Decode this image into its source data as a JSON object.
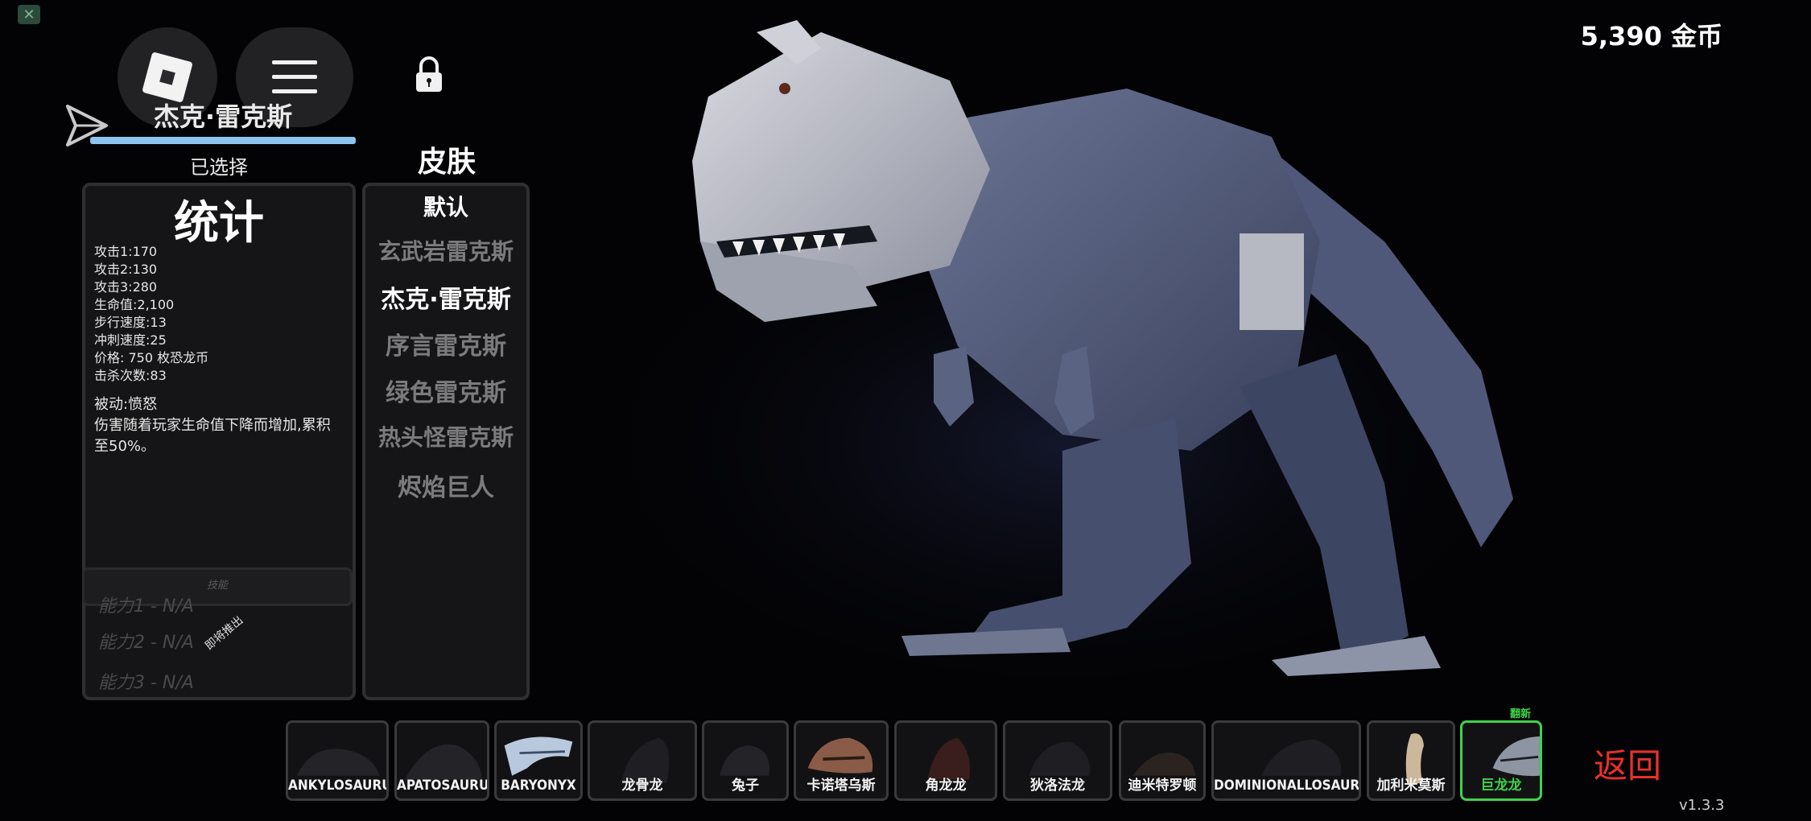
{
  "hud": {
    "close_icon": "close-icon",
    "roblox_logo_icon": "roblox-logo-icon",
    "menu_icon": "hamburger-menu-icon",
    "lock_icon": "lock-icon",
    "share_icon": "paper-plane-icon"
  },
  "dinosaur": {
    "name": "杰克·雷克斯",
    "selected_label": "已选择"
  },
  "stats": {
    "title": "统计",
    "lines": [
      "攻击1:170",
      "攻击2:130",
      "攻击3:280",
      "生命值:2,100",
      "步行速度:13",
      "冲刺速度:25",
      "价格: 750 枚恐龙币",
      "击杀次数:83"
    ],
    "passive_title": "被动:愤怒",
    "passive_desc": "伤害随着玩家生命值下降而增加,累积至50%。",
    "abilities_header": "技能",
    "abilities": [
      "能力1 - N/A",
      "能力2 - N/A",
      "能力3 - N/A"
    ],
    "coming_soon": "即将推出"
  },
  "skins": {
    "title": "皮肤",
    "items": [
      {
        "label": "默认",
        "state": "default"
      },
      {
        "label": "玄武岩雷克斯",
        "state": "locked"
      },
      {
        "label": "杰克·雷克斯",
        "state": "selected"
      },
      {
        "label": "序言雷克斯",
        "state": "locked"
      },
      {
        "label": "绿色雷克斯",
        "state": "locked"
      },
      {
        "label": "热头怪雷克斯",
        "state": "locked"
      },
      {
        "label": "烬焰巨人",
        "state": "locked"
      }
    ]
  },
  "currency": {
    "coins": "5,390 金币"
  },
  "roster": {
    "selected_tag": "翻新",
    "cards": [
      {
        "name": "ANKYLOSAURUS"
      },
      {
        "name": "APATOSAURUS"
      },
      {
        "name": "BARYONYX"
      },
      {
        "name": "龙骨龙"
      },
      {
        "name": "兔子"
      },
      {
        "name": "卡诺塔乌斯"
      },
      {
        "name": "角龙龙"
      },
      {
        "name": "狄洛法龙"
      },
      {
        "name": "迪米特罗顿"
      },
      {
        "name": "DOMINIONALLOSAURUS"
      },
      {
        "name": "加利米莫斯"
      },
      {
        "name": "巨龙龙"
      }
    ]
  },
  "footer": {
    "back_label": "返回",
    "version": "v1.3.3"
  },
  "colors": {
    "accent_selected": "#3fd44a",
    "back_red": "#e8302a",
    "name_bar": "#8cc4ee"
  }
}
